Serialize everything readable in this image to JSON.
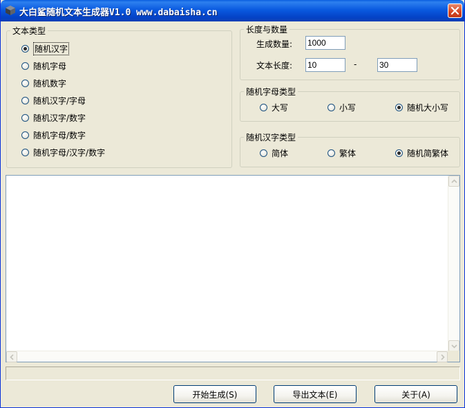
{
  "window": {
    "title": "大白鲨随机文本生成器V1.0 www.dabaisha.cn"
  },
  "text_type": {
    "legend": "文本类型",
    "options": [
      "随机汉字",
      "随机字母",
      "随机数字",
      "随机汉字/字母",
      "随机汉字/数字",
      "随机字母/数字",
      "随机字母/汉字/数字"
    ],
    "selected": 0
  },
  "length_count": {
    "legend": "长度与数量",
    "count_label": "生成数量:",
    "count_value": "1000",
    "length_label": "文本长度:",
    "length_min": "10",
    "length_sep": "-",
    "length_max": "30"
  },
  "letter_case": {
    "legend": "随机字母类型",
    "options": [
      "大写",
      "小写",
      "随机大小写"
    ],
    "selected": 2
  },
  "hanzi_type": {
    "legend": "随机汉字类型",
    "options": [
      "简体",
      "繁体",
      "随机简繁体"
    ],
    "selected": 2
  },
  "output": {
    "text": ""
  },
  "status": {
    "text": ""
  },
  "buttons": {
    "start": "开始生成(S)",
    "export": "导出文本(E)",
    "about": "关于(A)"
  },
  "icons": {
    "app": "cube-icon",
    "close": "close-icon"
  },
  "colors": {
    "title_bar": "#0a5ae0",
    "close_button": "#d44320",
    "window_bg": "#ece9d8"
  }
}
